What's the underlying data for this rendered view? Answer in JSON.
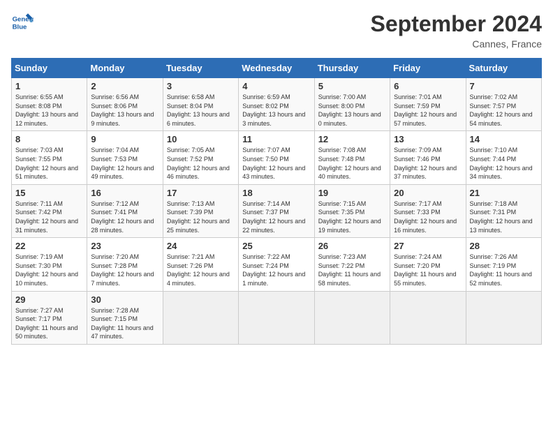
{
  "app": {
    "name_line1": "General",
    "name_line2": "Blue"
  },
  "header": {
    "month": "September 2024",
    "location": "Cannes, France"
  },
  "days_of_week": [
    "Sunday",
    "Monday",
    "Tuesday",
    "Wednesday",
    "Thursday",
    "Friday",
    "Saturday"
  ],
  "weeks": [
    [
      {
        "day": "1",
        "sunrise": "6:55 AM",
        "sunset": "8:08 PM",
        "daylight": "13 hours and 12 minutes."
      },
      {
        "day": "2",
        "sunrise": "6:56 AM",
        "sunset": "8:06 PM",
        "daylight": "13 hours and 9 minutes."
      },
      {
        "day": "3",
        "sunrise": "6:58 AM",
        "sunset": "8:04 PM",
        "daylight": "13 hours and 6 minutes."
      },
      {
        "day": "4",
        "sunrise": "6:59 AM",
        "sunset": "8:02 PM",
        "daylight": "13 hours and 3 minutes."
      },
      {
        "day": "5",
        "sunrise": "7:00 AM",
        "sunset": "8:00 PM",
        "daylight": "13 hours and 0 minutes."
      },
      {
        "day": "6",
        "sunrise": "7:01 AM",
        "sunset": "7:59 PM",
        "daylight": "12 hours and 57 minutes."
      },
      {
        "day": "7",
        "sunrise": "7:02 AM",
        "sunset": "7:57 PM",
        "daylight": "12 hours and 54 minutes."
      }
    ],
    [
      {
        "day": "8",
        "sunrise": "7:03 AM",
        "sunset": "7:55 PM",
        "daylight": "12 hours and 51 minutes."
      },
      {
        "day": "9",
        "sunrise": "7:04 AM",
        "sunset": "7:53 PM",
        "daylight": "12 hours and 49 minutes."
      },
      {
        "day": "10",
        "sunrise": "7:05 AM",
        "sunset": "7:52 PM",
        "daylight": "12 hours and 46 minutes."
      },
      {
        "day": "11",
        "sunrise": "7:07 AM",
        "sunset": "7:50 PM",
        "daylight": "12 hours and 43 minutes."
      },
      {
        "day": "12",
        "sunrise": "7:08 AM",
        "sunset": "7:48 PM",
        "daylight": "12 hours and 40 minutes."
      },
      {
        "day": "13",
        "sunrise": "7:09 AM",
        "sunset": "7:46 PM",
        "daylight": "12 hours and 37 minutes."
      },
      {
        "day": "14",
        "sunrise": "7:10 AM",
        "sunset": "7:44 PM",
        "daylight": "12 hours and 34 minutes."
      }
    ],
    [
      {
        "day": "15",
        "sunrise": "7:11 AM",
        "sunset": "7:42 PM",
        "daylight": "12 hours and 31 minutes."
      },
      {
        "day": "16",
        "sunrise": "7:12 AM",
        "sunset": "7:41 PM",
        "daylight": "12 hours and 28 minutes."
      },
      {
        "day": "17",
        "sunrise": "7:13 AM",
        "sunset": "7:39 PM",
        "daylight": "12 hours and 25 minutes."
      },
      {
        "day": "18",
        "sunrise": "7:14 AM",
        "sunset": "7:37 PM",
        "daylight": "12 hours and 22 minutes."
      },
      {
        "day": "19",
        "sunrise": "7:15 AM",
        "sunset": "7:35 PM",
        "daylight": "12 hours and 19 minutes."
      },
      {
        "day": "20",
        "sunrise": "7:17 AM",
        "sunset": "7:33 PM",
        "daylight": "12 hours and 16 minutes."
      },
      {
        "day": "21",
        "sunrise": "7:18 AM",
        "sunset": "7:31 PM",
        "daylight": "12 hours and 13 minutes."
      }
    ],
    [
      {
        "day": "22",
        "sunrise": "7:19 AM",
        "sunset": "7:30 PM",
        "daylight": "12 hours and 10 minutes."
      },
      {
        "day": "23",
        "sunrise": "7:20 AM",
        "sunset": "7:28 PM",
        "daylight": "12 hours and 7 minutes."
      },
      {
        "day": "24",
        "sunrise": "7:21 AM",
        "sunset": "7:26 PM",
        "daylight": "12 hours and 4 minutes."
      },
      {
        "day": "25",
        "sunrise": "7:22 AM",
        "sunset": "7:24 PM",
        "daylight": "12 hours and 1 minute."
      },
      {
        "day": "26",
        "sunrise": "7:23 AM",
        "sunset": "7:22 PM",
        "daylight": "11 hours and 58 minutes."
      },
      {
        "day": "27",
        "sunrise": "7:24 AM",
        "sunset": "7:20 PM",
        "daylight": "11 hours and 55 minutes."
      },
      {
        "day": "28",
        "sunrise": "7:26 AM",
        "sunset": "7:19 PM",
        "daylight": "11 hours and 52 minutes."
      }
    ],
    [
      {
        "day": "29",
        "sunrise": "7:27 AM",
        "sunset": "7:17 PM",
        "daylight": "11 hours and 50 minutes."
      },
      {
        "day": "30",
        "sunrise": "7:28 AM",
        "sunset": "7:15 PM",
        "daylight": "11 hours and 47 minutes."
      },
      null,
      null,
      null,
      null,
      null
    ]
  ]
}
